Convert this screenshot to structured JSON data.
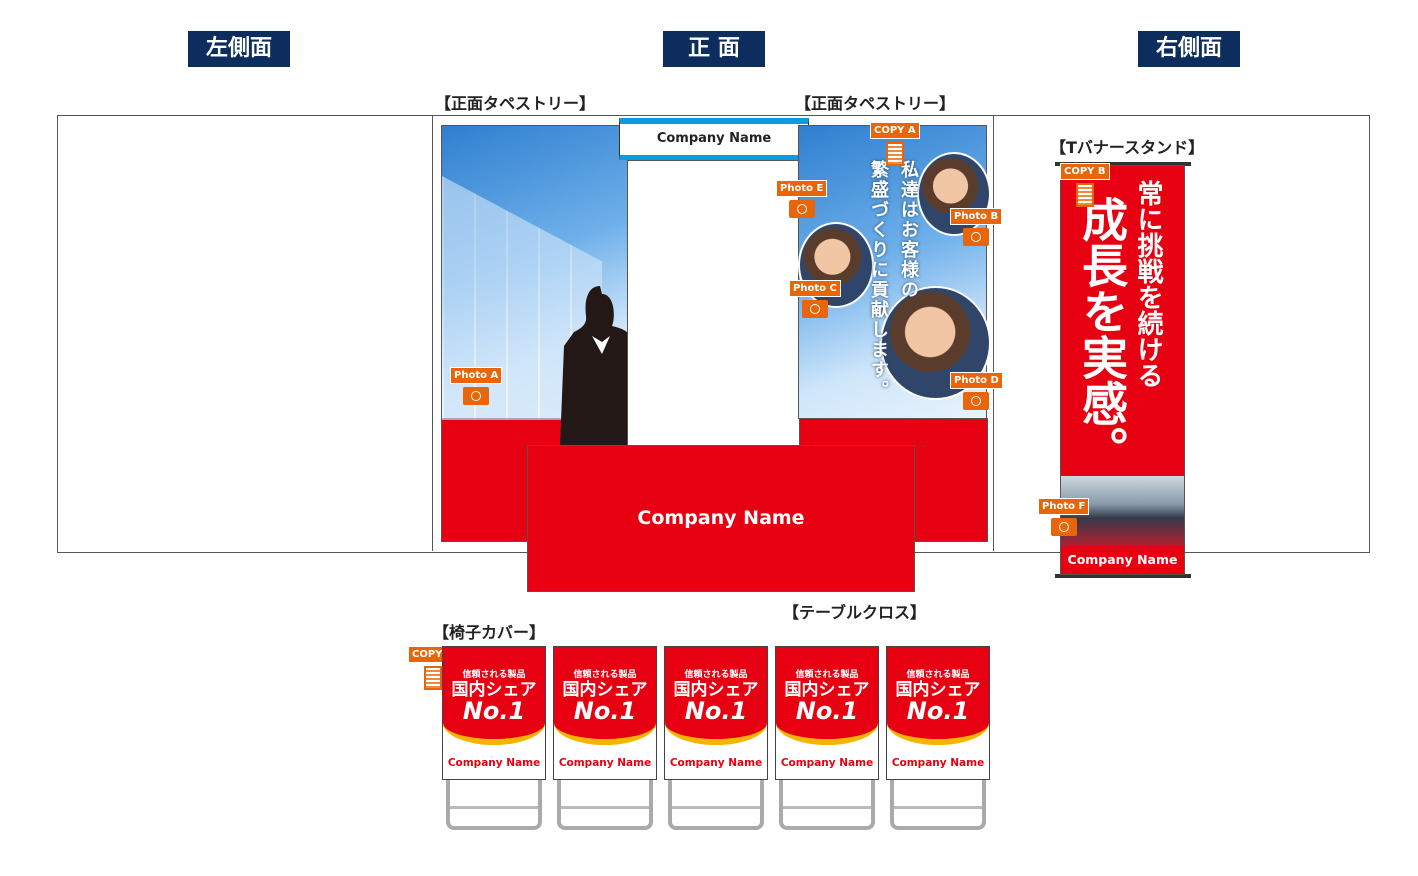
{
  "headers": {
    "left": "左側面",
    "front": "正 面",
    "right": "右側面"
  },
  "labels": {
    "tapestry_left": "【正面タペストリー】",
    "tapestry_right": "【正面タペストリー】",
    "t_banner": "【Tバナースタンド】",
    "table_cloth": "【テーブルクロス】",
    "chair_cover": "【椅子カバー】"
  },
  "front": {
    "header_sign": "Company Name",
    "table_cloth_text": "Company Name",
    "tapestry_copy_line1": "私達はお客様の",
    "tapestry_copy_line2": "繁盛づくりに貢献します。",
    "tags": {
      "photo_a": "Photo A",
      "photo_b": "Photo B",
      "photo_c": "Photo C",
      "photo_d": "Photo D",
      "photo_e": "Photo E",
      "copy_a": "COPY A"
    }
  },
  "banner": {
    "line1": "常に挑戦を続ける",
    "line2": "成長を実感。",
    "company": "Company Name",
    "tags": {
      "copy_b": "COPY B",
      "photo_f": "Photo F"
    }
  },
  "chairs": {
    "copy_c": "COPY C",
    "items": [
      {
        "small": "信頼される製品",
        "main": "国内シェア",
        "no": "No.1",
        "company": "Company Name"
      },
      {
        "small": "信頼される製品",
        "main": "国内シェア",
        "no": "No.1",
        "company": "Company Name"
      },
      {
        "small": "信頼される製品",
        "main": "国内シェア",
        "no": "No.1",
        "company": "Company Name"
      },
      {
        "small": "信頼される製品",
        "main": "国内シェア",
        "no": "No.1",
        "company": "Company Name"
      },
      {
        "small": "信頼される製品",
        "main": "国内シェア",
        "no": "No.1",
        "company": "Company Name"
      }
    ]
  },
  "colors": {
    "navy": "#0c2d5e",
    "red": "#e60012",
    "orange": "#e8650a",
    "yellow": "#f5b400",
    "blue": "#0a9be0"
  }
}
